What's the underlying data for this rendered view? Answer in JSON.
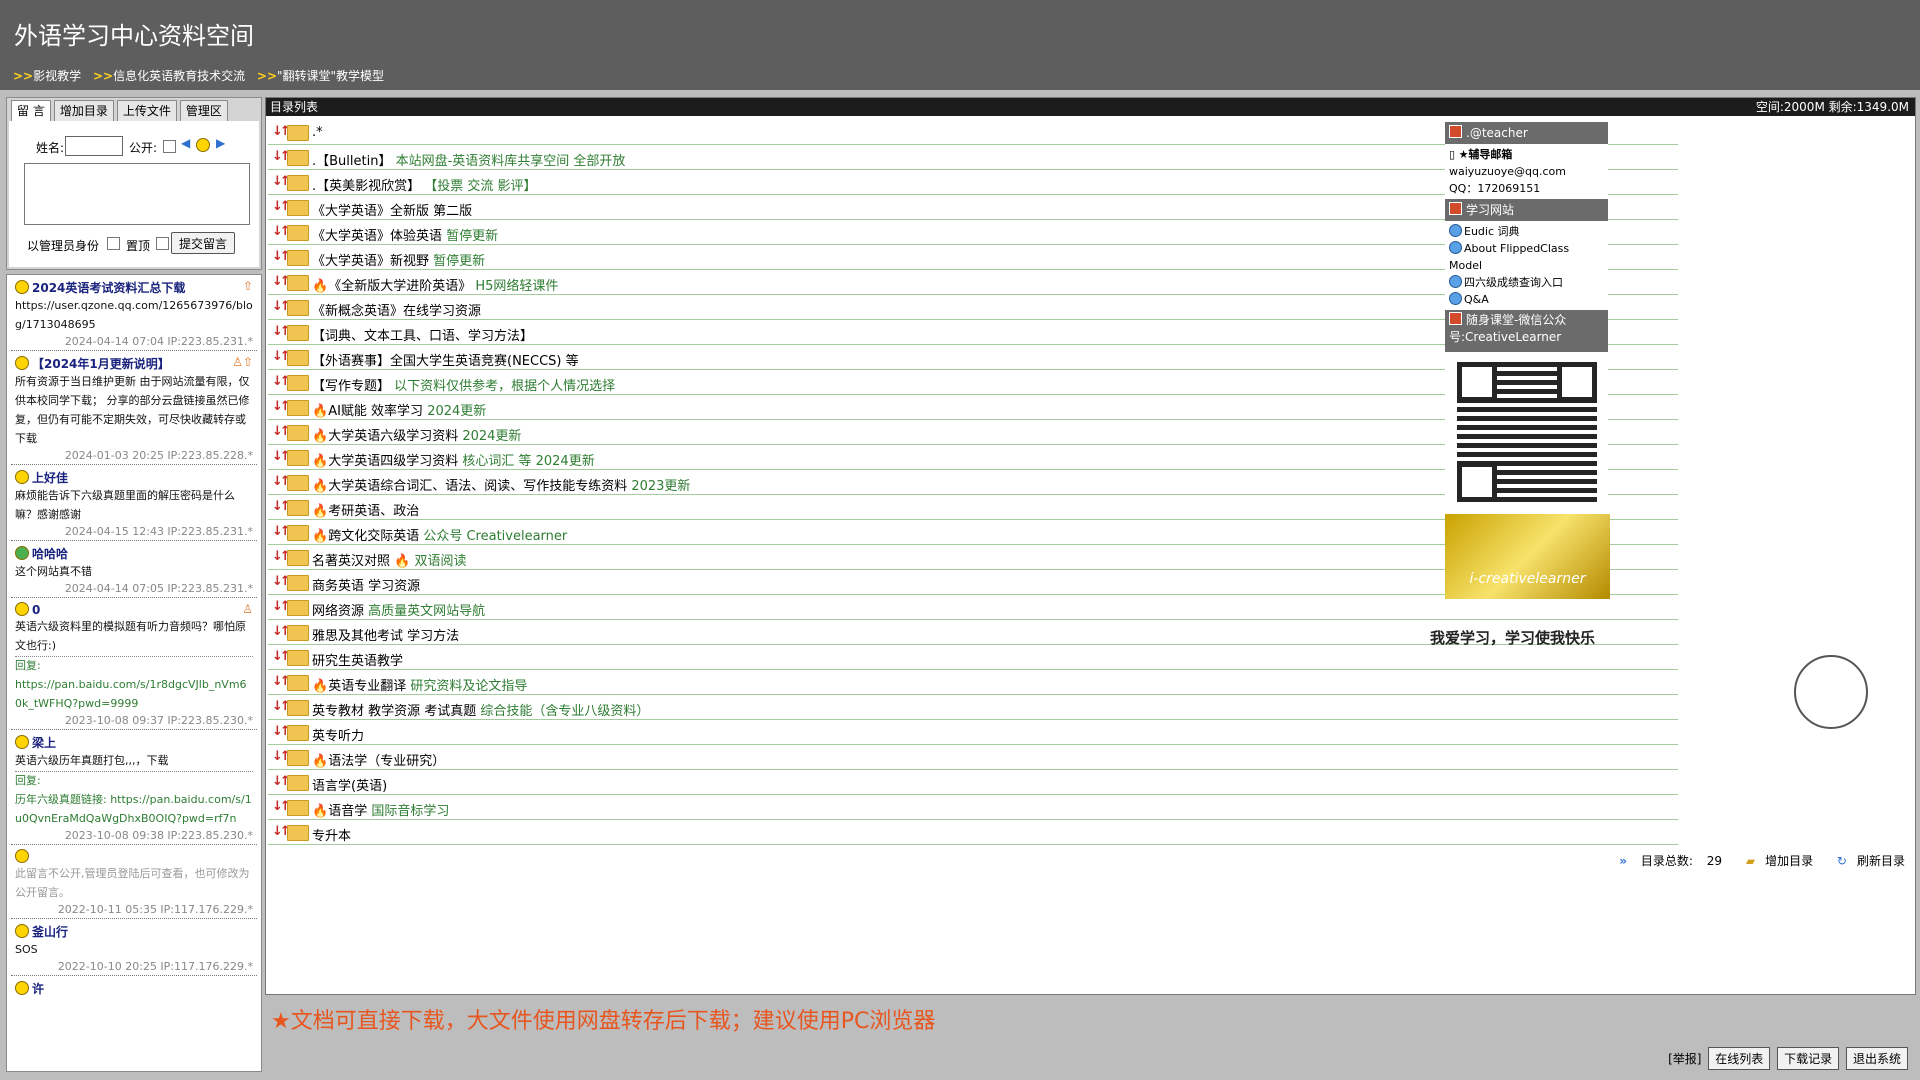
{
  "site_title": "外语学习中心资料空间",
  "top_links": [
    "影视教学",
    "信息化英语教育技术交流",
    "\"翻转课堂\"教学模型"
  ],
  "top_link_arrow": ">>",
  "left_form": {
    "tabs": [
      "留 言",
      "增加目录",
      "上传文件",
      "管理区"
    ],
    "name_label": "姓名:",
    "public_label": "公开:",
    "admin_label": "以管理员身份",
    "pin_label": "置顶",
    "submit_label": "提交留言"
  },
  "messages": [
    {
      "title": "2024英语考试资料汇总下载",
      "body": "https://user.qzone.qq.com/1265673976/blog/1713048695",
      "meta": "2024-04-14 07:04 IP:223.85.231.*"
    },
    {
      "title": "【2024年1月更新说明】",
      "body": "所有资源于当日维护更新 由于网站流量有限，仅供本校同学下载； 分享的部分云盘链接虽然已修复，但仍有可能不定期失效，可尽快收藏转存或下载",
      "meta": "2024-01-03 20:25 IP:223.85.228.*"
    },
    {
      "title": "上好佳",
      "body": "麻烦能告诉下六级真题里面的解压密码是什么嘛？感谢感谢",
      "meta": "2024-04-15 12:43 IP:223.85.231.*"
    },
    {
      "title": "哈哈哈",
      "body": "这个网站真不错",
      "meta": "2024-04-14 07:05 IP:223.85.231.*"
    },
    {
      "title": "0",
      "body": "英语六级资料里的模拟题有听力音频吗？哪怕原文也行:)",
      "reply_label": "回复:",
      "reply": "https://pan.baidu.com/s/1r8dgcVJlb_nVm60k_tWFHQ?pwd=9999",
      "meta": "2023-10-08 09:37 IP:223.85.230.*"
    },
    {
      "title": "梁上",
      "body": "英语六级历年真题打包,,,，下载",
      "reply_label": "回复:",
      "reply": "历年六级真题链接: https://pan.baidu.com/s/1u0QvnEraMdQaWgDhxB0OIQ?pwd=rf7n",
      "meta": "2023-10-08 09:38 IP:223.85.230.*"
    },
    {
      "title": "",
      "body": "此留言不公开,管理员登陆后可查看，也可修改为公开留言。",
      "meta": "2022-10-11 05:35 IP:117.176.229.*"
    },
    {
      "title": "釜山行",
      "body": "SOS",
      "meta": "2022-10-10 20:25 IP:117.176.229.*"
    },
    {
      "title": "许",
      "body": "",
      "meta": ""
    }
  ],
  "main": {
    "header_label": "目录列表",
    "space_info": "空间:2000M 剩余:1349.0M",
    "directories": [
      {
        "name": ".*",
        "note": "",
        "hot": false
      },
      {
        "name": ".【Bulletin】",
        "note": "本站网盘-英语资料库共享空间 全部开放",
        "hot": false
      },
      {
        "name": ".【英美影视欣赏】",
        "note": "【投票 交流 影评】",
        "hot": false
      },
      {
        "name": "《大学英语》全新版 第二版",
        "note": "",
        "hot": false
      },
      {
        "name": "《大学英语》体验英语",
        "note": "暂停更新",
        "hot": false
      },
      {
        "name": "《大学英语》新视野",
        "note": "暂停更新",
        "hot": false
      },
      {
        "name": "《全新版大学进阶英语》",
        "note": "H5网络轻课件",
        "hot": true
      },
      {
        "name": "《新概念英语》在线学习资源",
        "note": "",
        "hot": false
      },
      {
        "name": "【词典、文本工具、口语、学习方法】",
        "note": "",
        "hot": false
      },
      {
        "name": "【外语赛事】全国大学生英语竞赛(NECCS) 等",
        "note": "",
        "hot": false
      },
      {
        "name": "【写作专题】",
        "note": "以下资料仅供参考，根据个人情况选择",
        "hot": false
      },
      {
        "name": "AI赋能 效率学习",
        "note": "2024更新",
        "hot": true
      },
      {
        "name": "大学英语六级学习资料",
        "note": "2024更新",
        "hot": true
      },
      {
        "name": "大学英语四级学习资料",
        "note": "核心词汇 等 2024更新",
        "hot": true
      },
      {
        "name": "大学英语综合词汇、语法、阅读、写作技能专练资料",
        "note": "2023更新",
        "hot": true
      },
      {
        "name": "考研英语、政治",
        "note": "",
        "hot": true
      },
      {
        "name": "跨文化交际英语",
        "note": "公众号 Creativelearner",
        "hot": true
      },
      {
        "name": "名著英汉对照",
        "note": "双语阅读",
        "hot": false,
        "hot_note": true
      },
      {
        "name": "商务英语 学习资源",
        "note": "",
        "hot": false
      },
      {
        "name": "网络资源",
        "note": "高质量英文网站导航",
        "hot": false
      },
      {
        "name": "雅思及其他考试 学习方法",
        "note": "",
        "hot": false
      },
      {
        "name": "研究生英语教学",
        "note": "",
        "hot": false
      },
      {
        "name": "英语专业翻译",
        "note": "研究资料及论文指导",
        "hot": true
      },
      {
        "name": "英专教材 教学资源 考试真题",
        "note": "综合技能（含专业八级资料）",
        "hot": false
      },
      {
        "name": "英专听力",
        "note": "",
        "hot": false
      },
      {
        "name": "语法学（专业研究）",
        "note": "",
        "hot": true
      },
      {
        "name": "语言学(英语)",
        "note": "",
        "hot": false
      },
      {
        "name": "语音学",
        "note": "国际音标学习",
        "hot": true
      },
      {
        "name": "专升本",
        "note": "",
        "hot": false
      }
    ],
    "total_label": "目录总数:",
    "total_count": "29",
    "add_dir": "增加目录",
    "refresh_dir": "刷新目录"
  },
  "right_panel": {
    "teacher_header": ".@teacher",
    "mailbox_label": "★辅导邮箱",
    "email": "waiyuzuoye@qq.com",
    "qq": "QQ：172069151",
    "sites_header": "学习网站",
    "sites": [
      "Eudic 词典",
      "About FlippedClass Model",
      "四六级成绩查询入口",
      "Q&A"
    ],
    "wechat_header": "随身课堂-微信公众号:CreativeLearner",
    "banner_text": "i-creativelearner",
    "mascot_text": "我爱学习，学习使我快乐"
  },
  "notice": "★文档可直接下载，大文件使用网盘转存后下载；建议使用PC浏览器",
  "bottom_bar": {
    "report": "[举报]",
    "buttons": [
      "在线列表",
      "下载记录",
      "退出系统"
    ]
  }
}
